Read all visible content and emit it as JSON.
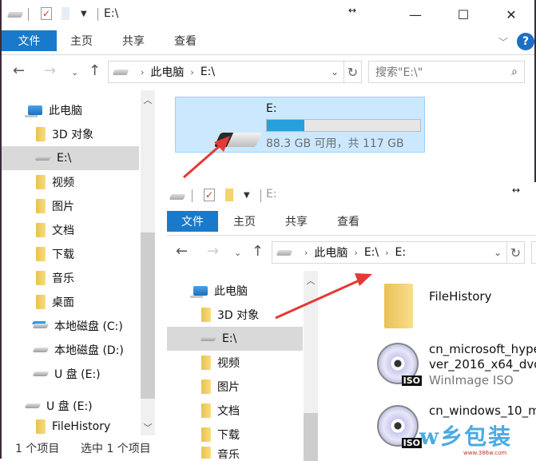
{
  "back_window": {
    "title": "E:\\",
    "quick_access": [
      "drive-icon",
      "properties-icon",
      "new-folder-icon",
      "customize-dropdown"
    ],
    "window_controls": {
      "minimize": "—",
      "maximize": "☐",
      "close": "✕"
    },
    "ribbon_tabs": [
      "文件",
      "主页",
      "共享",
      "查看"
    ],
    "help_label": "?",
    "breadcrumb": [
      "此电脑",
      "E:\\"
    ],
    "search_placeholder": "搜索\"E:\\\"",
    "nav_tree": [
      {
        "label": "此电脑",
        "icon": "pc-icon",
        "level": 0
      },
      {
        "label": "3D 对象",
        "icon": "folder-3d-icon",
        "level": 1
      },
      {
        "label": "E:\\",
        "icon": "drive-icon",
        "level": 1,
        "selected": true
      },
      {
        "label": "视频",
        "icon": "folder-video-icon",
        "level": 1
      },
      {
        "label": "图片",
        "icon": "folder-pictures-icon",
        "level": 1
      },
      {
        "label": "文档",
        "icon": "folder-documents-icon",
        "level": 1
      },
      {
        "label": "下载",
        "icon": "folder-downloads-icon",
        "level": 1
      },
      {
        "label": "音乐",
        "icon": "folder-music-icon",
        "level": 1
      },
      {
        "label": "桌面",
        "icon": "folder-desktop-icon",
        "level": 1
      },
      {
        "label": "本地磁盘 (C:)",
        "icon": "windows-drive-icon",
        "level": 1
      },
      {
        "label": "本地磁盘 (D:)",
        "icon": "drive-icon",
        "level": 1
      },
      {
        "label": "U 盘 (E:)",
        "icon": "drive-icon",
        "level": 1
      },
      {
        "label": "U 盘 (E:)",
        "icon": "drive-icon",
        "level": 0
      },
      {
        "label": "FileHistory",
        "icon": "folder-icon",
        "level": 1
      }
    ],
    "drive_tile": {
      "name": "E:",
      "space_text": "88.3 GB 可用，共 117 GB",
      "used_fraction": 0.245
    },
    "status": {
      "count": "1 个项目",
      "selected": "选中 1 个项目"
    }
  },
  "front_window": {
    "title": "E:",
    "ribbon_tabs": [
      "文件",
      "主页",
      "共享",
      "查看"
    ],
    "breadcrumb": [
      "此电脑",
      "E:\\",
      "E:"
    ],
    "nav_tree": [
      {
        "label": "此电脑",
        "icon": "pc-icon",
        "level": 0
      },
      {
        "label": "3D 对象",
        "icon": "folder-3d-icon",
        "level": 1
      },
      {
        "label": "E:\\",
        "icon": "drive-icon",
        "level": 1,
        "selected": true
      },
      {
        "label": "视频",
        "icon": "folder-video-icon",
        "level": 1
      },
      {
        "label": "图片",
        "icon": "folder-pictures-icon",
        "level": 1
      },
      {
        "label": "文档",
        "icon": "folder-documents-icon",
        "level": 1
      },
      {
        "label": "下载",
        "icon": "folder-downloads-icon",
        "level": 1
      },
      {
        "label": "音乐",
        "icon": "folder-music-icon",
        "level": 1
      }
    ],
    "items": [
      {
        "name": "FileHistory",
        "type": "folder"
      },
      {
        "name_line1": "cn_microsoft_hype",
        "name_line2": "ver_2016_x64_dvd",
        "type_label": "WinImage ISO",
        "type": "iso"
      },
      {
        "name_line1": "cn_windows_10_m",
        "type": "iso"
      }
    ]
  },
  "watermark": {
    "text": "w乡包装",
    "url": "www.386w.com"
  },
  "colors": {
    "accent": "#1979ca",
    "selection": "#cce8ff",
    "usage_fill": "#26a0da",
    "annotation": "#e53935"
  }
}
